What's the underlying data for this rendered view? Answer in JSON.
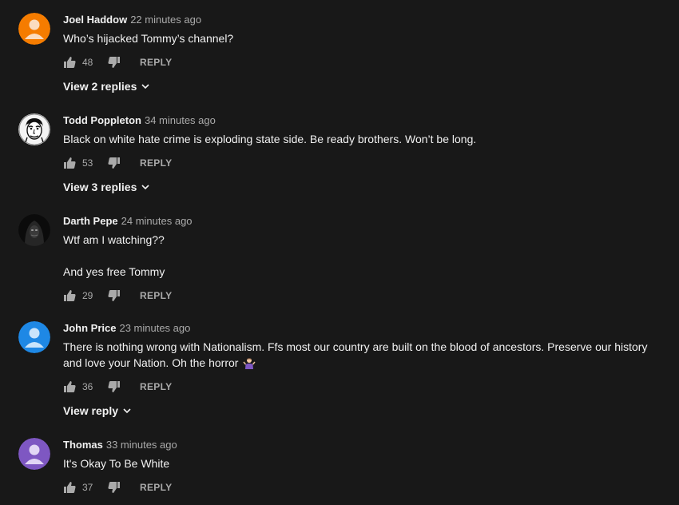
{
  "comments": [
    {
      "author": "Joel Haddow",
      "time": "22 minutes ago",
      "text": "Who’s hijacked Tommy’s channel?",
      "likes": "48",
      "reply_label": "REPLY",
      "view_replies": "View 2 replies",
      "avatar": {
        "type": "default",
        "color": "#f57c00"
      }
    },
    {
      "author": "Todd Poppleton",
      "time": "34 minutes ago",
      "text": "Black on white hate crime is exploding state side. Be ready brothers. Won’t be long.",
      "likes": "53",
      "reply_label": "REPLY",
      "view_replies": "View 3 replies",
      "avatar": {
        "type": "photo-face-bw"
      }
    },
    {
      "author": "Darth Pepe",
      "time": "24 minutes ago",
      "text": "Wtf am I watching??\n\nAnd yes free Tommy",
      "likes": "29",
      "reply_label": "REPLY",
      "avatar": {
        "type": "photo-dark-hood"
      }
    },
    {
      "author": "John Price",
      "time": "23 minutes ago",
      "text": "There is nothing wrong with Nationalism. Ffs most our country are built on the blood of ancestors. Preserve our history and love your Nation. Oh the horror",
      "emoji": "person-shrugging-emoji",
      "likes": "36",
      "reply_label": "REPLY",
      "view_replies": "View reply",
      "avatar": {
        "type": "default",
        "color": "#1e88e5"
      }
    },
    {
      "author": "Thomas",
      "time": "33 minutes ago",
      "text": "It's Okay To Be White",
      "likes": "37",
      "reply_label": "REPLY",
      "avatar": {
        "type": "default",
        "color": "#7e57c2"
      }
    }
  ]
}
